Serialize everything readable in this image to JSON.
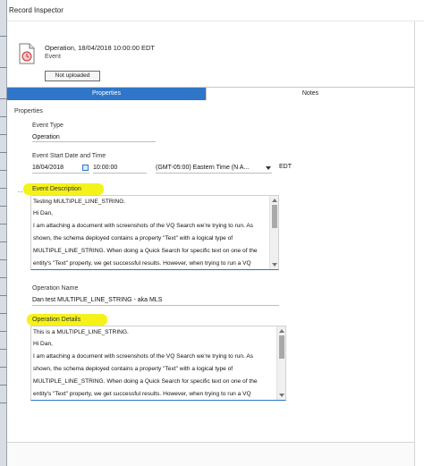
{
  "window": {
    "title": "Record Inspector"
  },
  "record": {
    "title": "Operation, 18/04/2018 10:00:00 EDT",
    "type": "Event",
    "upload_status": "Not uploaded"
  },
  "tabs": [
    {
      "label": "Properties",
      "active": true
    },
    {
      "label": "Notes",
      "active": false
    }
  ],
  "section_label": "Properties",
  "ellipsis": "...",
  "fields": {
    "event_type": {
      "label": "Event Type",
      "value": "Operation"
    },
    "event_start": {
      "label": "Event Start Date and Time",
      "date": "18/04/2018",
      "time": "10:00:00",
      "timezone": "(GMT-05:00) Eastern Time (N A...",
      "tz_abbrev": "EDT"
    },
    "event_description": {
      "label": "Event Description",
      "lines": [
        "Testing  MULTIPLE_LINE_STRING.",
        "Hi Dan,",
        "I am attaching a document with screenshots of the VQ Search we're trying to run. As",
        "shown, the schema deployed contains a property \"Text\" with a logical type of",
        "MULTIPLE_LINE_STRING. When doing a Quick Search for specific text on one of the",
        "entity's \"Text\" property, we get successful results. However, when trying to run a VQ"
      ]
    },
    "operation_name": {
      "label": "Operation Name",
      "value": "Dan test  MULTIPLE_LINE_STRING - aka MLS"
    },
    "operation_details": {
      "label": "Operation Details",
      "lines": [
        "This is a MULTIPLE_LINE_STRING.",
        "Hi Dan,",
        "I am attaching a document with screenshots of the VQ Search we're trying to run. As",
        "shown, the schema deployed contains a property \"Text\" with a logical type of",
        "MULTIPLE_LINE_STRING. When doing a Quick Search for specific text on one of the",
        "entity's \"Text\" property, we get successful results. However, when trying to run a VQ"
      ]
    }
  },
  "colors": {
    "accent": "#2f76c8",
    "highlight": "#f5f21a"
  }
}
